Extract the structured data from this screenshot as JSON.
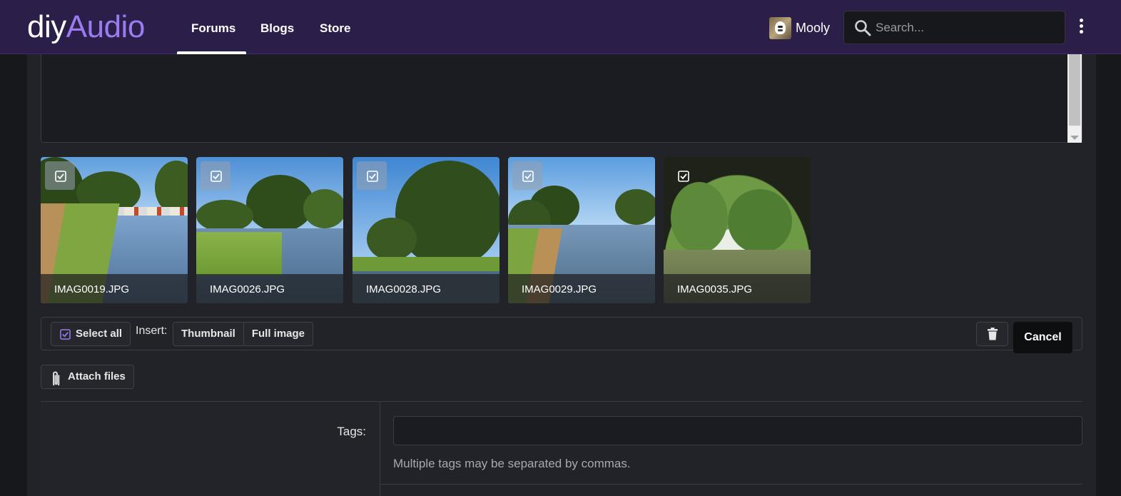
{
  "header": {
    "logo_part1": "diy",
    "logo_part2": "Audio",
    "nav": [
      "Forums",
      "Blogs",
      "Store"
    ],
    "active_nav": "Forums",
    "user_name": "Mooly",
    "search_placeholder": "Search..."
  },
  "attachments": [
    {
      "filename": "IMAG0019.JPG",
      "checked": true
    },
    {
      "filename": "IMAG0026.JPG",
      "checked": true
    },
    {
      "filename": "IMAG0028.JPG",
      "checked": true
    },
    {
      "filename": "IMAG0029.JPG",
      "checked": true
    },
    {
      "filename": "IMAG0035.JPG",
      "checked": true
    }
  ],
  "toolbar": {
    "select_all": "Select all",
    "insert_label": "Insert:",
    "thumbnail": "Thumbnail",
    "full_image": "Full image",
    "cancel": "Cancel"
  },
  "attach_files": "Attach files",
  "tags": {
    "label": "Tags:",
    "value": "",
    "hint": "Multiple tags may be separated by commas."
  },
  "colors": {
    "header_bg": "#2b1f4a",
    "accent": "#9b7cf0",
    "page_bg": "#17181c",
    "panel_bg": "#222328"
  }
}
